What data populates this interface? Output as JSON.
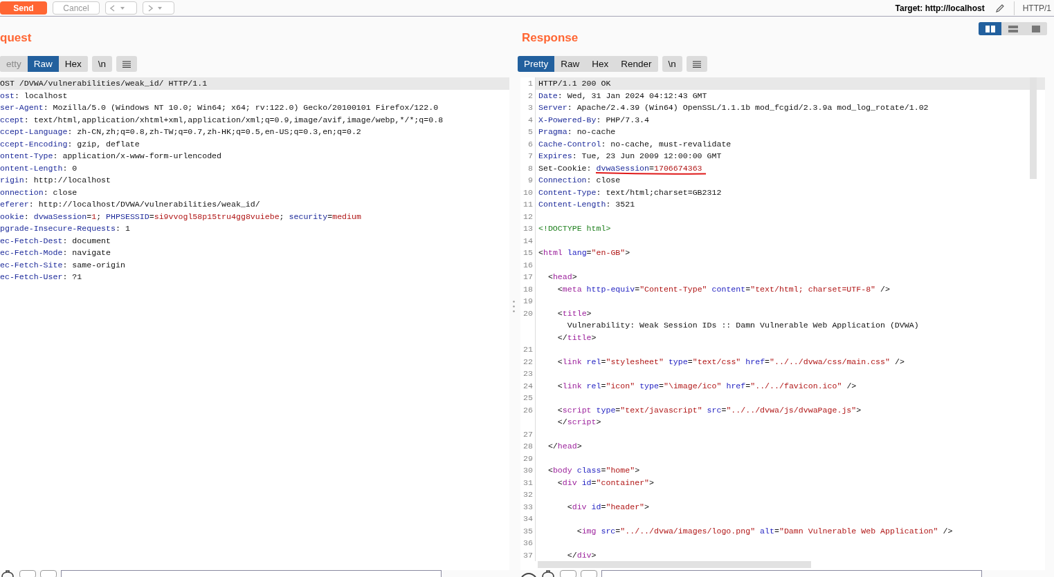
{
  "toolbar": {
    "send_label": "Send",
    "cancel_label": "Cancel",
    "target": "Target: http://localhost",
    "protocol": "HTTP/1"
  },
  "request": {
    "title": "quest",
    "tabs": [
      {
        "label": "etty",
        "selected": false
      },
      {
        "label": "Raw",
        "selected": true
      },
      {
        "label": "Hex",
        "selected": false
      }
    ],
    "newline_label": "\\n",
    "lines": [
      {
        "highlighted": true,
        "segments": [
          {
            "kind": "plain",
            "text": "OST /DVWA/vulnerabilities/weak_id/ HTTP/1.1"
          }
        ]
      },
      {
        "highlighted": false,
        "segments": [
          {
            "kind": "name",
            "text": "ost"
          },
          {
            "kind": "plain",
            "text": ": localhost"
          }
        ]
      },
      {
        "highlighted": false,
        "segments": [
          {
            "kind": "name",
            "text": "ser-Agent"
          },
          {
            "kind": "plain",
            "text": ": Mozilla/5.0 (Windows NT 10.0; Win64; x64; rv:122.0) Gecko/20100101 Firefox/122.0"
          }
        ]
      },
      {
        "highlighted": false,
        "segments": [
          {
            "kind": "name",
            "text": "ccept"
          },
          {
            "kind": "plain",
            "text": ": text/html,application/xhtml+xml,application/xml;q=0.9,image/avif,image/webp,*/*;q=0.8"
          }
        ]
      },
      {
        "highlighted": false,
        "segments": [
          {
            "kind": "name",
            "text": "ccept-Language"
          },
          {
            "kind": "plain",
            "text": ": zh-CN,zh;q=0.8,zh-TW;q=0.7,zh-HK;q=0.5,en-US;q=0.3,en;q=0.2"
          }
        ]
      },
      {
        "highlighted": false,
        "segments": [
          {
            "kind": "name",
            "text": "ccept-Encoding"
          },
          {
            "kind": "plain",
            "text": ": gzip, deflate"
          }
        ]
      },
      {
        "highlighted": false,
        "segments": [
          {
            "kind": "name",
            "text": "ontent-Type"
          },
          {
            "kind": "plain",
            "text": ": application/x-www-form-urlencoded"
          }
        ]
      },
      {
        "highlighted": false,
        "segments": [
          {
            "kind": "name",
            "text": "ontent-Length"
          },
          {
            "kind": "plain",
            "text": ": 0"
          }
        ]
      },
      {
        "highlighted": false,
        "segments": [
          {
            "kind": "name",
            "text": "rigin"
          },
          {
            "kind": "plain",
            "text": ": http://localhost"
          }
        ]
      },
      {
        "highlighted": false,
        "segments": [
          {
            "kind": "name",
            "text": "onnection"
          },
          {
            "kind": "plain",
            "text": ": close"
          }
        ]
      },
      {
        "highlighted": false,
        "segments": [
          {
            "kind": "name",
            "text": "eferer"
          },
          {
            "kind": "plain",
            "text": ": http://localhost/DVWA/vulnerabilities/weak_id/"
          }
        ]
      },
      {
        "highlighted": false,
        "segments": [
          {
            "kind": "name",
            "text": "ookie"
          },
          {
            "kind": "plain",
            "text": ": "
          },
          {
            "kind": "name",
            "text": "dvwaSession"
          },
          {
            "kind": "plain",
            "text": "="
          },
          {
            "kind": "value",
            "text": "1"
          },
          {
            "kind": "plain",
            "text": "; "
          },
          {
            "kind": "name",
            "text": "PHPSESSID"
          },
          {
            "kind": "plain",
            "text": "="
          },
          {
            "kind": "value",
            "text": "si9vvogl58p15tru4gg8vuiebe"
          },
          {
            "kind": "plain",
            "text": "; "
          },
          {
            "kind": "name",
            "text": "security"
          },
          {
            "kind": "plain",
            "text": "="
          },
          {
            "kind": "value",
            "text": "medium"
          }
        ]
      },
      {
        "highlighted": false,
        "segments": [
          {
            "kind": "name",
            "text": "pgrade-Insecure-Requests"
          },
          {
            "kind": "plain",
            "text": ": 1"
          }
        ]
      },
      {
        "highlighted": false,
        "segments": [
          {
            "kind": "name",
            "text": "ec-Fetch-Dest"
          },
          {
            "kind": "plain",
            "text": ": document"
          }
        ]
      },
      {
        "highlighted": false,
        "segments": [
          {
            "kind": "name",
            "text": "ec-Fetch-Mode"
          },
          {
            "kind": "plain",
            "text": ": navigate"
          }
        ]
      },
      {
        "highlighted": false,
        "segments": [
          {
            "kind": "name",
            "text": "ec-Fetch-Site"
          },
          {
            "kind": "plain",
            "text": ": same-origin"
          }
        ]
      },
      {
        "highlighted": false,
        "segments": [
          {
            "kind": "name",
            "text": "ec-Fetch-User"
          },
          {
            "kind": "plain",
            "text": ": ?1"
          }
        ]
      }
    ]
  },
  "response": {
    "title": "Response",
    "layout_modes": [
      {
        "selected": true
      },
      {
        "selected": false
      },
      {
        "selected": false
      }
    ],
    "tabs": [
      {
        "label": "Pretty",
        "selected": true
      },
      {
        "label": "Raw",
        "selected": false
      },
      {
        "label": "Hex",
        "selected": false
      },
      {
        "label": "Render",
        "selected": false
      }
    ],
    "newline_label": "\\n",
    "lines": [
      {
        "number": "1",
        "highlighted": true,
        "rows": [
          {
            "segments": [
              {
                "kind": "plain",
                "text": "HTTP/1.1 200 OK"
              }
            ]
          }
        ]
      },
      {
        "number": "2",
        "highlighted": false,
        "rows": [
          {
            "segments": [
              {
                "kind": "name",
                "text": "Date"
              },
              {
                "kind": "plain",
                "text": ": Wed, 31 Jan 2024 04:12:43 GMT"
              }
            ]
          }
        ]
      },
      {
        "number": "3",
        "highlighted": false,
        "rows": [
          {
            "segments": [
              {
                "kind": "name",
                "text": "Server"
              },
              {
                "kind": "plain",
                "text": ": Apache/2.4.39 (Win64) OpenSSL/1.1.1b mod_fcgid/2.3.9a mod_log_rotate/1.02"
              }
            ]
          }
        ]
      },
      {
        "number": "4",
        "highlighted": false,
        "rows": [
          {
            "segments": [
              {
                "kind": "name",
                "text": "X-Powered-By"
              },
              {
                "kind": "plain",
                "text": ": PHP/7.3.4"
              }
            ]
          }
        ]
      },
      {
        "number": "5",
        "highlighted": false,
        "rows": [
          {
            "segments": [
              {
                "kind": "name",
                "text": "Pragma"
              },
              {
                "kind": "plain",
                "text": ": no-cache"
              }
            ]
          }
        ]
      },
      {
        "number": "6",
        "highlighted": false,
        "rows": [
          {
            "segments": [
              {
                "kind": "name",
                "text": "Cache-Control"
              },
              {
                "kind": "plain",
                "text": ": no-cache, must-revalidate"
              }
            ]
          }
        ]
      },
      {
        "number": "7",
        "highlighted": false,
        "rows": [
          {
            "segments": [
              {
                "kind": "name",
                "text": "Expires"
              },
              {
                "kind": "plain",
                "text": ": Tue, 23 Jun 2009 12:00:00 GMT"
              }
            ]
          }
        ]
      },
      {
        "number": "8",
        "highlighted": false,
        "rows": [
          {
            "segments": [
              {
                "kind": "plain",
                "text": "Set-Cookie: ",
                "marked": false
              },
              {
                "kind": "name",
                "text": "dvwaSession",
                "marked": true
              },
              {
                "kind": "plain",
                "text": "=",
                "marked": true
              },
              {
                "kind": "value",
                "text": "1706674363",
                "marked": true
              }
            ]
          }
        ]
      },
      {
        "number": "9",
        "highlighted": false,
        "rows": [
          {
            "segments": [
              {
                "kind": "name",
                "text": "Connection"
              },
              {
                "kind": "plain",
                "text": ": close"
              }
            ]
          }
        ]
      },
      {
        "number": "10",
        "highlighted": false,
        "rows": [
          {
            "segments": [
              {
                "kind": "name",
                "text": "Content-Type"
              },
              {
                "kind": "plain",
                "text": ": text/html;charset=GB2312"
              }
            ]
          }
        ]
      },
      {
        "number": "11",
        "highlighted": false,
        "rows": [
          {
            "segments": [
              {
                "kind": "name",
                "text": "Content-Length"
              },
              {
                "kind": "plain",
                "text": ": 3521"
              }
            ]
          }
        ]
      },
      {
        "number": "12",
        "highlighted": false
      },
      {
        "number": "13",
        "highlighted": false,
        "rows": [
          {
            "segments": [
              {
                "kind": "doctype",
                "text": "<!DOCTYPE html>"
              }
            ]
          }
        ]
      },
      {
        "number": "14",
        "highlighted": false
      },
      {
        "number": "15",
        "highlighted": false,
        "rows": [
          {
            "segments": [
              {
                "kind": "plain",
                "text": "<"
              },
              {
                "kind": "tag",
                "text": "html"
              },
              {
                "kind": "attr",
                "text": " lang"
              },
              {
                "kind": "plain",
                "text": "="
              },
              {
                "kind": "value",
                "text": "\"en-GB\""
              },
              {
                "kind": "plain",
                "text": ">"
              }
            ]
          }
        ]
      },
      {
        "number": "16",
        "highlighted": false
      },
      {
        "number": "17",
        "highlighted": false,
        "rows": [
          {
            "segments": [
              {
                "kind": "plain",
                "text": "  <"
              },
              {
                "kind": "tag",
                "text": "head"
              },
              {
                "kind": "plain",
                "text": ">"
              }
            ]
          }
        ]
      },
      {
        "number": "18",
        "highlighted": false,
        "rows": [
          {
            "segments": [
              {
                "kind": "plain",
                "text": "    <"
              },
              {
                "kind": "tag",
                "text": "meta"
              },
              {
                "kind": "attr",
                "text": " http-equiv"
              },
              {
                "kind": "plain",
                "text": "="
              },
              {
                "kind": "value",
                "text": "\"Content-Type\""
              },
              {
                "kind": "attr",
                "text": " content"
              },
              {
                "kind": "plain",
                "text": "="
              },
              {
                "kind": "value",
                "text": "\"text/html; charset=UTF-8\""
              },
              {
                "kind": "plain",
                "text": " />"
              }
            ]
          }
        ]
      },
      {
        "number": "19",
        "highlighted": false
      },
      {
        "number": "20",
        "highlighted": false,
        "rows": [
          {
            "segments": [
              {
                "kind": "plain",
                "text": "    <"
              },
              {
                "kind": "tag",
                "text": "title"
              },
              {
                "kind": "plain",
                "text": ">"
              }
            ]
          },
          {
            "segments": [
              {
                "kind": "plain",
                "text": "      Vulnerability: Weak Session IDs :: Damn Vulnerable Web Application (DVWA)"
              }
            ]
          },
          {
            "segments": [
              {
                "kind": "plain",
                "text": "    </"
              },
              {
                "kind": "tag",
                "text": "title"
              },
              {
                "kind": "plain",
                "text": ">"
              }
            ]
          }
        ]
      },
      {
        "number": "21",
        "highlighted": false
      },
      {
        "number": "22",
        "highlighted": false,
        "rows": [
          {
            "segments": [
              {
                "kind": "plain",
                "text": "    <"
              },
              {
                "kind": "tag",
                "text": "link"
              },
              {
                "kind": "attr",
                "text": " rel"
              },
              {
                "kind": "plain",
                "text": "="
              },
              {
                "kind": "value",
                "text": "\"stylesheet\""
              },
              {
                "kind": "attr",
                "text": " type"
              },
              {
                "kind": "plain",
                "text": "="
              },
              {
                "kind": "value",
                "text": "\"text/css\""
              },
              {
                "kind": "attr",
                "text": " href"
              },
              {
                "kind": "plain",
                "text": "="
              },
              {
                "kind": "value",
                "text": "\"../../dvwa/css/main.css\""
              },
              {
                "kind": "plain",
                "text": " />"
              }
            ]
          }
        ]
      },
      {
        "number": "23",
        "highlighted": false
      },
      {
        "number": "24",
        "highlighted": false,
        "rows": [
          {
            "segments": [
              {
                "kind": "plain",
                "text": "    <"
              },
              {
                "kind": "tag",
                "text": "link"
              },
              {
                "kind": "attr",
                "text": " rel"
              },
              {
                "kind": "plain",
                "text": "="
              },
              {
                "kind": "value",
                "text": "\"icon\""
              },
              {
                "kind": "attr",
                "text": " type"
              },
              {
                "kind": "plain",
                "text": "="
              },
              {
                "kind": "value",
                "text": "\"\\image/ico\""
              },
              {
                "kind": "attr",
                "text": " href"
              },
              {
                "kind": "plain",
                "text": "="
              },
              {
                "kind": "value",
                "text": "\"../../favicon.ico\""
              },
              {
                "kind": "plain",
                "text": " />"
              }
            ]
          }
        ]
      },
      {
        "number": "25",
        "highlighted": false
      },
      {
        "number": "26",
        "highlighted": false,
        "rows": [
          {
            "segments": [
              {
                "kind": "plain",
                "text": "    <"
              },
              {
                "kind": "tag",
                "text": "script"
              },
              {
                "kind": "attr",
                "text": " type"
              },
              {
                "kind": "plain",
                "text": "="
              },
              {
                "kind": "value",
                "text": "\"text/javascript\""
              },
              {
                "kind": "attr",
                "text": " src"
              },
              {
                "kind": "plain",
                "text": "="
              },
              {
                "kind": "value",
                "text": "\"../../dvwa/js/dvwaPage.js\""
              },
              {
                "kind": "plain",
                "text": ">"
              }
            ]
          },
          {
            "segments": [
              {
                "kind": "plain",
                "text": "    </"
              },
              {
                "kind": "tag",
                "text": "script"
              },
              {
                "kind": "plain",
                "text": ">"
              }
            ]
          }
        ]
      },
      {
        "number": "27",
        "highlighted": false
      },
      {
        "number": "28",
        "highlighted": false,
        "rows": [
          {
            "segments": [
              {
                "kind": "plain",
                "text": "  </"
              },
              {
                "kind": "tag",
                "text": "head"
              },
              {
                "kind": "plain",
                "text": ">"
              }
            ]
          }
        ]
      },
      {
        "number": "29",
        "highlighted": false
      },
      {
        "number": "30",
        "highlighted": false,
        "rows": [
          {
            "segments": [
              {
                "kind": "plain",
                "text": "  <"
              },
              {
                "kind": "tag",
                "text": "body"
              },
              {
                "kind": "attr",
                "text": " class"
              },
              {
                "kind": "plain",
                "text": "="
              },
              {
                "kind": "value",
                "text": "\"home\""
              },
              {
                "kind": "plain",
                "text": ">"
              }
            ]
          }
        ]
      },
      {
        "number": "31",
        "highlighted": false,
        "rows": [
          {
            "segments": [
              {
                "kind": "plain",
                "text": "    <"
              },
              {
                "kind": "tag",
                "text": "div"
              },
              {
                "kind": "attr",
                "text": " id"
              },
              {
                "kind": "plain",
                "text": "="
              },
              {
                "kind": "value",
                "text": "\"container\""
              },
              {
                "kind": "plain",
                "text": ">"
              }
            ]
          }
        ]
      },
      {
        "number": "32",
        "highlighted": false
      },
      {
        "number": "33",
        "highlighted": false,
        "rows": [
          {
            "segments": [
              {
                "kind": "plain",
                "text": "      <"
              },
              {
                "kind": "tag",
                "text": "div"
              },
              {
                "kind": "attr",
                "text": " id"
              },
              {
                "kind": "plain",
                "text": "="
              },
              {
                "kind": "value",
                "text": "\"header\""
              },
              {
                "kind": "plain",
                "text": ">"
              }
            ]
          }
        ]
      },
      {
        "number": "34",
        "highlighted": false
      },
      {
        "number": "35",
        "highlighted": false,
        "rows": [
          {
            "segments": [
              {
                "kind": "plain",
                "text": "        <"
              },
              {
                "kind": "tag",
                "text": "img"
              },
              {
                "kind": "attr",
                "text": " src"
              },
              {
                "kind": "plain",
                "text": "="
              },
              {
                "kind": "value",
                "text": "\"../../dvwa/images/logo.png\""
              },
              {
                "kind": "attr",
                "text": " alt"
              },
              {
                "kind": "plain",
                "text": "="
              },
              {
                "kind": "value",
                "text": "\"Damn Vulnerable Web Application\""
              },
              {
                "kind": "plain",
                "text": " />"
              }
            ]
          }
        ]
      },
      {
        "number": "36",
        "highlighted": false
      },
      {
        "number": "37",
        "highlighted": false,
        "rows": [
          {
            "segments": [
              {
                "kind": "plain",
                "text": "      </"
              },
              {
                "kind": "tag",
                "text": "div"
              },
              {
                "kind": "plain",
                "text": ">"
              }
            ]
          }
        ]
      }
    ]
  }
}
